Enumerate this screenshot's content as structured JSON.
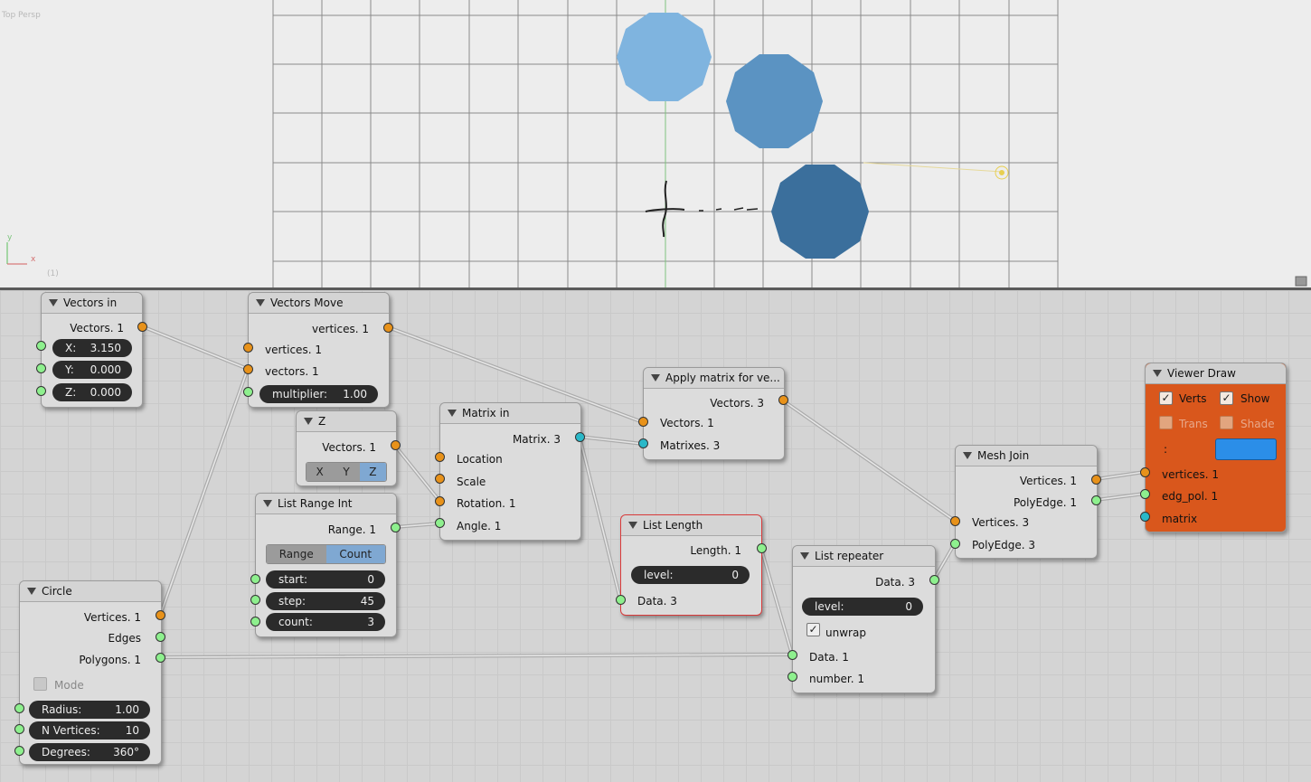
{
  "viewport": {
    "view_label": "Top Persp",
    "frame_label": "(1)",
    "axis_y": "y",
    "axis_x": "x"
  },
  "nodes": {
    "vectors_in": {
      "title": "Vectors in",
      "out": "Vectors. 1",
      "x": {
        "label": "X:",
        "value": "3.150"
      },
      "y": {
        "label": "Y:",
        "value": "0.000"
      },
      "z": {
        "label": "Z:",
        "value": "0.000"
      }
    },
    "vectors_move": {
      "title": "Vectors Move",
      "out": "vertices. 1",
      "in1": "vertices. 1",
      "in2": "vectors. 1",
      "mult_label": "multiplier:",
      "mult_value": "1.00"
    },
    "z_node": {
      "title": "Z",
      "out": "Vectors. 1",
      "bx": "X",
      "by": "Y",
      "bz": "Z"
    },
    "list_range_int": {
      "title": "List Range Int",
      "out": "Range. 1",
      "mode_range": "Range",
      "mode_count": "Count",
      "start_label": "start:",
      "start_value": "0",
      "step_label": "step:",
      "step_value": "45",
      "count_label": "count:",
      "count_value": "3"
    },
    "matrix_in": {
      "title": "Matrix in",
      "out": "Matrix. 3",
      "in_location": "Location",
      "in_scale": "Scale",
      "in_rotation": "Rotation. 1",
      "in_angle": "Angle. 1"
    },
    "apply_matrix": {
      "title": "Apply matrix for ve...",
      "out": "Vectors. 3",
      "in_vectors": "Vectors. 1",
      "in_matrixes": "Matrixes. 3"
    },
    "list_length": {
      "title": "List Length",
      "out": "Length. 1",
      "level_label": "level:",
      "level_value": "0",
      "in_data": "Data. 3"
    },
    "list_repeater": {
      "title": "List repeater",
      "out": "Data. 3",
      "level_label": "level:",
      "level_value": "0",
      "unwrap_label": "unwrap",
      "in_data": "Data. 1",
      "in_number": "number. 1"
    },
    "mesh_join": {
      "title": "Mesh Join",
      "out_vertices": "Vertices. 1",
      "out_polyedge": "PolyEdge. 1",
      "in_vertices": "Vertices. 3",
      "in_polyedge": "PolyEdge. 3"
    },
    "viewer_draw": {
      "title": "Viewer Draw",
      "verts_label": "Verts",
      "show_label": "Show",
      "trans_label": "Trans",
      "shade_label": "Shade",
      "colon_label": ":",
      "color": "#2b8ee8",
      "in_vertices": "vertices. 1",
      "in_edg_pol": "edg_pol. 1",
      "in_matrix": "matrix"
    },
    "circle": {
      "title": "Circle",
      "out_vertices": "Vertices. 1",
      "out_edges": "Edges",
      "out_polygons": "Polygons. 1",
      "mode_label": "Mode",
      "radius_label": "Radius:",
      "radius_value": "1.00",
      "nverts_label": "N Vertices:",
      "nverts_value": "10",
      "degrees_label": "Degrees:",
      "degrees_value": "360°"
    }
  },
  "colors": {
    "socket_vertices": "#e8921a",
    "socket_data": "#8ef08e",
    "socket_matrix": "#29b8c8",
    "polygon_1": "#7fb4df",
    "polygon_2": "#5b93c2",
    "polygon_3": "#3b6f9c",
    "viewer_node": "#d9571c"
  }
}
